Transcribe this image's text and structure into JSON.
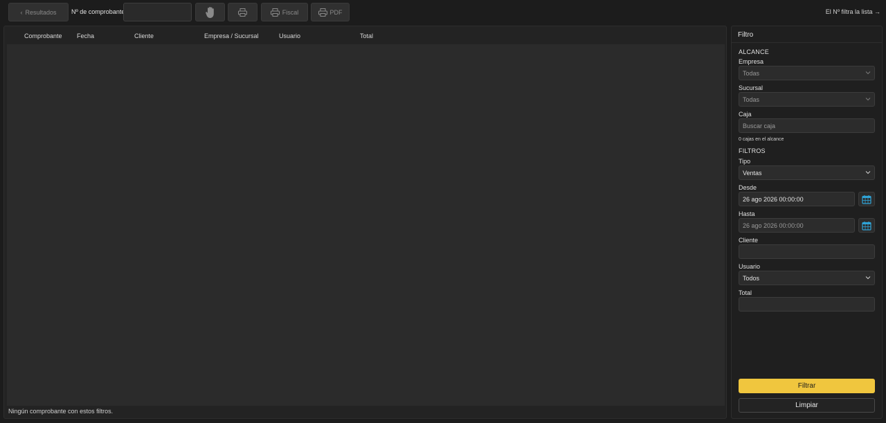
{
  "toolbar": {
    "results_button": "Resultados",
    "results_chevron": "‹",
    "receipt_number_label": "Nº de comprobante",
    "receipt_number_value": "",
    "fiscal_label": "Fiscal",
    "pdf_label": "PDF",
    "hint": "El Nº filtra la lista →"
  },
  "table": {
    "columns": [
      "Comprobante",
      "Fecha",
      "Cliente",
      "Empresa / Sucursal",
      "Usuario",
      "Total"
    ],
    "rows": [],
    "empty_message": "Ningún comprobante con estos filtros."
  },
  "filter": {
    "title": "Filtro",
    "scope_section": "ALCANCE",
    "empresa_label": "Empresa",
    "empresa_value": "Todas",
    "sucursal_label": "Sucursal",
    "sucursal_value": "Todas",
    "caja_label": "Caja",
    "caja_placeholder": "Buscar caja",
    "cajas_note": "0 cajas en el alcance",
    "filters_section": "FILTROS",
    "tipo_label": "Tipo",
    "tipo_value": "Ventas",
    "desde_label": "Desde",
    "desde_value": "26 ago 2026 00:00:00",
    "hasta_label": "Hasta",
    "hasta_value": "26 ago 2026 00:00:00",
    "cliente_label": "Cliente",
    "cliente_value": "",
    "usuario_label": "Usuario",
    "usuario_value": "Todos",
    "total_label": "Total",
    "total_value": "",
    "filtrar_button": "Filtrar",
    "limpiar_button": "Limpiar"
  },
  "colors": {
    "accent": "#f0c63e",
    "calendar_icon": "#2fa3d6",
    "background": "#1c1c1c"
  },
  "icons": [
    "chevron-left-icon",
    "hand-icon",
    "printer-icon",
    "chevron-down-icon",
    "calendar-icon"
  ]
}
